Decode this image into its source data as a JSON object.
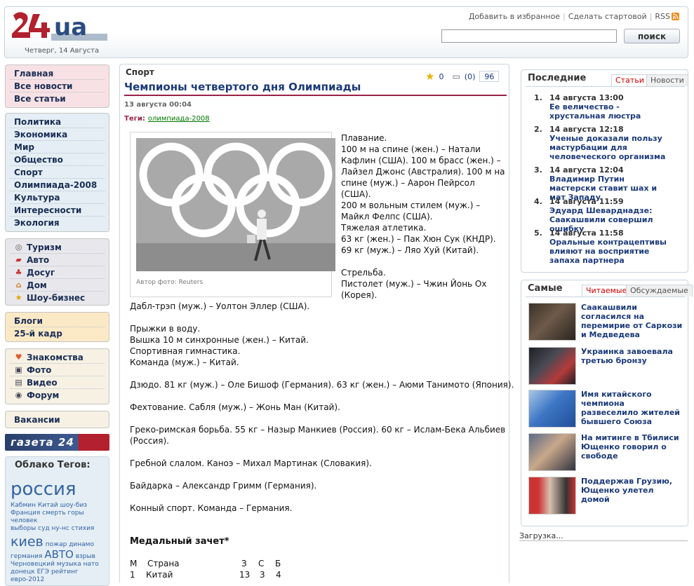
{
  "header": {
    "logo_text": "24ua",
    "date": "Четверг, 14 Августа",
    "links": [
      "Добавить в избранное",
      "Сделать стартовой",
      "RSS"
    ],
    "search_placeholder": "",
    "search_button": "поиск"
  },
  "nav": {
    "group1": [
      "Главная",
      "Все новости",
      "Все статьи"
    ],
    "group2": [
      "Политика",
      "Экономика",
      "Мир",
      "Общество",
      "Спорт",
      "Олимпиада-2008",
      "Культура",
      "Интересности",
      "Экология"
    ],
    "group3": [
      {
        "label": "Туризм",
        "icon": "compass-icon"
      },
      {
        "label": "Авто",
        "icon": "car-icon"
      },
      {
        "label": "Досуг",
        "icon": "leisure-icon"
      },
      {
        "label": "Дом",
        "icon": "house-icon"
      },
      {
        "label": "Шоу-бизнес",
        "icon": "star-icon"
      }
    ],
    "group4": [
      "Блоги",
      "25-й кадр"
    ],
    "group5": [
      {
        "label": "Знакомства",
        "icon": "heart-icon"
      },
      {
        "label": "Фото",
        "icon": "camera-icon"
      },
      {
        "label": "Видео",
        "icon": "video-icon"
      },
      {
        "label": "Форум",
        "icon": "forum-icon"
      }
    ],
    "group6": [
      "Вакансии"
    ],
    "gazeta": "газета 24",
    "tags_title": "Облако Тегов:",
    "tags": {
      "t1": "россия",
      "t2": "Кабмин",
      "t3": "Китай",
      "t4": "шоу-биз",
      "t5": "Франция",
      "t6": "смерть",
      "t7": "горы",
      "t8": "человек",
      "t9": "выборы",
      "t10": "суд",
      "t11": "ну-нс",
      "t12": "стихия",
      "t13": "киев",
      "t14": "пожар",
      "t15": "динамо",
      "t16": "германия",
      "t17": "АВТО",
      "t18": "взрыв",
      "t19": "Черновецкий",
      "t20": "музыка",
      "t21": "нато",
      "t22": "донецк",
      "t23": "ЕГЭ",
      "t24": "рейтинг",
      "t25": "евро-2012"
    }
  },
  "article": {
    "section": "Спорт",
    "title": "Чемпионы четвертого дня Олимпиады",
    "date": "13 августа 00:04",
    "tags_label": "Теги:",
    "tag": "олимпиада-2008",
    "rating": "0",
    "comments": "(0)",
    "views": "96",
    "photo_caption": "Автор фото: Reuters",
    "p1": [
      "Плавание.",
      "100 м на спине (жен.) – Натали",
      "Кафлин (США). 100 м брасс (жен.) –",
      "Лайзел Джонс (Австралия). 100 м на",
      "спине (муж.) – Аарон Пейрсол (США).",
      "200 м вольным стилем (муж.) –",
      "Майкл Фелпс (США)."
    ],
    "p2": [
      "Тяжелая атлетика.",
      "63 кг (жен.) – Пак Хюн Сук (КНДР).",
      "69 кг (муж.) – Ляо Хуй (Китай)."
    ],
    "p3": [
      "Стрельба.",
      "Пистолет (муж.) – Чжин Йонь Ох",
      "(Корея)."
    ],
    "p3b": "Дабл-трэп (муж.) – Уолтон Эллер (США).",
    "p4": [
      "Прыжки в воду.",
      "Вышка 10 м синхронные (жен.) – Китай.",
      "Спортивная гимнастика.",
      "Команда (муж.) – Китай."
    ],
    "p5": "Дзюдо. 81 кг (муж.) – Оле Бишоф (Германия). 63 кг (жен.) – Аюми Танимото (Япония).",
    "p6": "Фехтование. Сабля (муж.) – Жонь Ман (Китай).",
    "p7a": "Греко-римская борьба. 55 кг – Назыр Манкиев (Россия). 60 кг – Ислам-Бека Альбиев",
    "p7b": "(Россия).",
    "p8": "Гребной слалом. Каноэ – Михал Мартинак (Словакия).",
    "p9": "Байдарка – Александр Гримм (Германия).",
    "p10": "Конный спорт. Команда – Германия.",
    "medal_title": "Медальный зачет*",
    "medal_header": [
      "М",
      "Страна",
      "З",
      "С",
      "Б"
    ],
    "medal_row": [
      "1",
      "Китай",
      "13",
      "3",
      "4"
    ]
  },
  "latest": {
    "title": "Последние",
    "tab_active": "Статьи",
    "tab_other": "Новости",
    "items": [
      {
        "n": "1.",
        "date": "14 августа 13:00",
        "title": "Ее величество - хрустальная люстра"
      },
      {
        "n": "2.",
        "date": "14 августа 12:18",
        "title": "Ученые доказали пользу мастурбации для человеческого организма"
      },
      {
        "n": "3.",
        "date": "14 августа 12:04",
        "title": "Владимир Путин мастерски ставит шах и мат Западу"
      },
      {
        "n": "4.",
        "date": "14 августа 11:59",
        "title": "Эдуард Шеварднадзе: Саакашвили совершил ошибку"
      },
      {
        "n": "5.",
        "date": "14 августа 11:58",
        "title": "Оральные контрацептивы влияют на восприятие запаха партнера"
      }
    ]
  },
  "most": {
    "title": "Самые",
    "tab_active": "Читаемые",
    "tab_other": "Обсуждаемые",
    "items": [
      {
        "title": "Саакашвили согласился на перемирие от Саркози и Медведева"
      },
      {
        "title": "Украинка завоевала третью бронзу"
      },
      {
        "title": "Имя китайского чемпиона развеселило жителей бывшего Союза"
      },
      {
        "title": "На митинге в Тбилиси Ющенко говорил о свободе"
      },
      {
        "title": "Поддержав Грузию, Ющенко улетел домой"
      }
    ]
  },
  "loading": "Загрузка...",
  "colors": {
    "nav_pink": "#f8e1e4",
    "nav_blue": "#e4eef4",
    "nav_gray": "#e8e8ec",
    "nav_yellow": "#fbe9c6",
    "nav_beige": "#f6f1e3",
    "title_blue": "#1b3a7a",
    "accent_red": "#9b2247"
  }
}
